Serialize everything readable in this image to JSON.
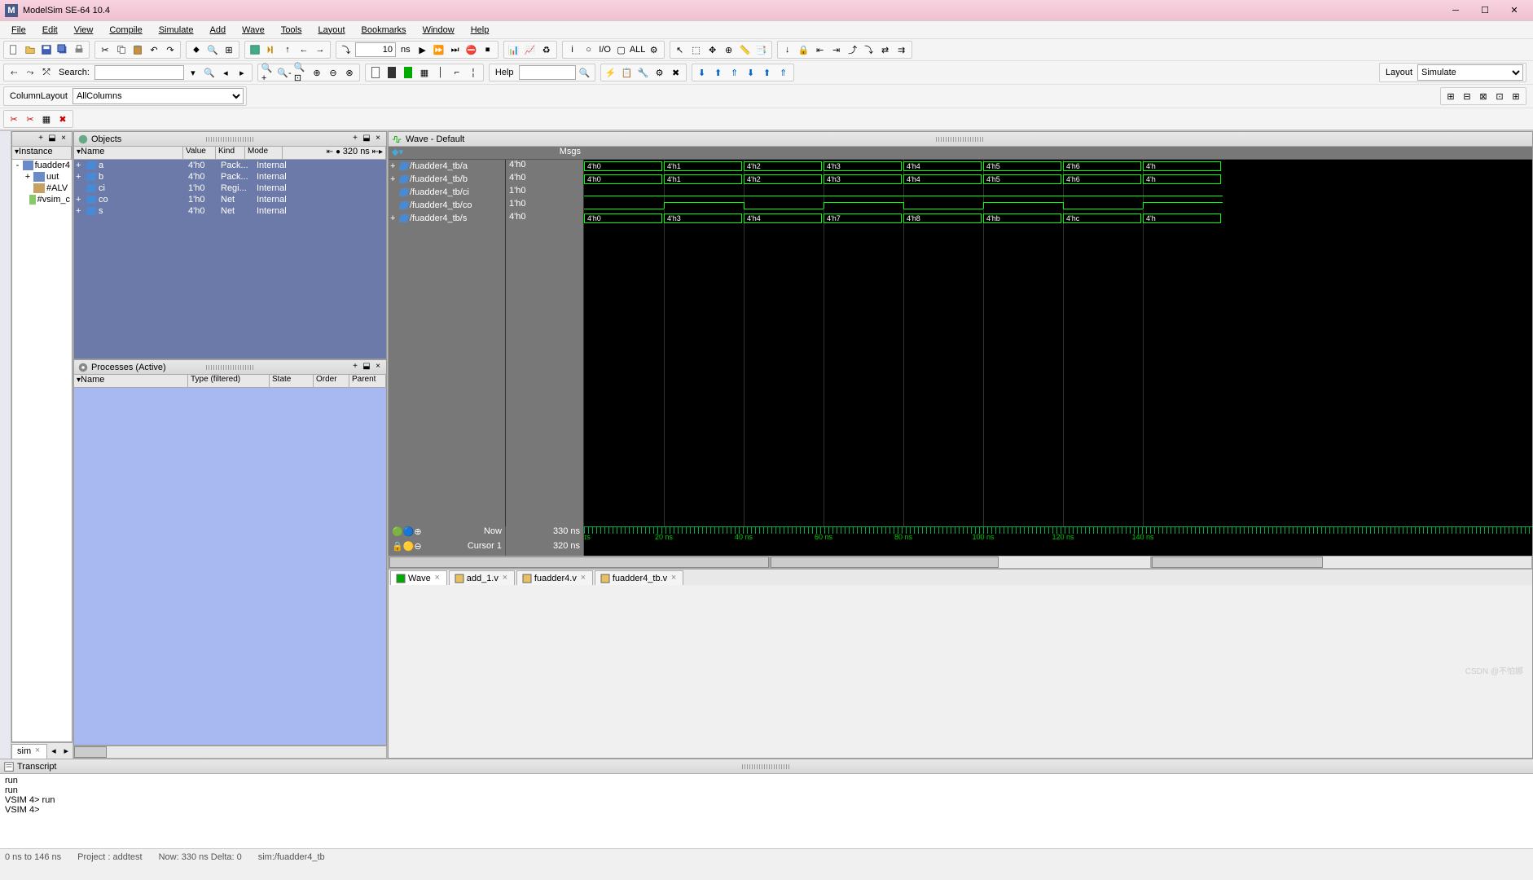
{
  "app": {
    "title": "ModelSim SE-64 10.4",
    "logo": "M"
  },
  "menus": [
    "File",
    "Edit",
    "View",
    "Compile",
    "Simulate",
    "Add",
    "Wave",
    "Tools",
    "Layout",
    "Bookmarks",
    "Window",
    "Help"
  ],
  "toolbar": {
    "time_value": "10",
    "time_unit": "ns",
    "search_label": "Search:",
    "column_layout_label": "ColumnLayout",
    "column_layout_value": "AllColumns",
    "help_label": "Help",
    "layout_label": "Layout",
    "layout_value": "Simulate"
  },
  "instance_panel": {
    "title": "",
    "header": "Instance",
    "items": [
      {
        "exp": "-",
        "icon": "module",
        "label": "fuadder4"
      },
      {
        "exp": "+",
        "icon": "module",
        "label": "uut",
        "indent": 1
      },
      {
        "exp": "",
        "icon": "package",
        "label": "#ALV",
        "indent": 1
      },
      {
        "exp": "",
        "icon": "chart",
        "label": "#vsim_c",
        "indent": 1
      }
    ]
  },
  "objects_panel": {
    "title": "Objects",
    "columns": [
      "Name",
      "Value",
      "Kind",
      "Mode"
    ],
    "time_marker": "320 ns",
    "rows": [
      {
        "exp": "+",
        "name": "a",
        "value": "4'h0",
        "kind": "Pack...",
        "mode": "Internal"
      },
      {
        "exp": "+",
        "name": "b",
        "value": "4'h0",
        "kind": "Pack...",
        "mode": "Internal"
      },
      {
        "exp": "",
        "name": "ci",
        "value": "1'h0",
        "kind": "Regi...",
        "mode": "Internal"
      },
      {
        "exp": "+",
        "name": "co",
        "value": "1'h0",
        "kind": "Net",
        "mode": "Internal"
      },
      {
        "exp": "+",
        "name": "s",
        "value": "4'h0",
        "kind": "Net",
        "mode": "Internal"
      }
    ]
  },
  "processes_panel": {
    "title": "Processes (Active)",
    "columns": [
      "Name",
      "Type (filtered)",
      "State",
      "Order",
      "Parent"
    ]
  },
  "wave_panel": {
    "title": "Wave - Default",
    "msgs_header": "Msgs",
    "signals": [
      {
        "exp": "+",
        "name": "/fuadder4_tb/a",
        "msg": "4'h0"
      },
      {
        "exp": "+",
        "name": "/fuadder4_tb/b",
        "msg": "4'h0"
      },
      {
        "exp": "",
        "name": "/fuadder4_tb/ci",
        "msg": "1'h0"
      },
      {
        "exp": "",
        "name": "/fuadder4_tb/co",
        "msg": "1'h0"
      },
      {
        "exp": "+",
        "name": "/fuadder4_tb/s",
        "msg": "4'h0"
      }
    ],
    "bus_a": [
      "4'h0",
      "4'h1",
      "4'h2",
      "4'h3",
      "4'h4",
      "4'h5",
      "4'h6",
      "4'h"
    ],
    "bus_b": [
      "4'h0",
      "4'h1",
      "4'h2",
      "4'h3",
      "4'h4",
      "4'h5",
      "4'h6",
      "4'h"
    ],
    "bus_s": [
      "4'h0",
      "4'h3",
      "4'h4",
      "4'h7",
      "4'h8",
      "4'hb",
      "4'hc",
      "4'h"
    ],
    "ruler": [
      "20 ns",
      "40 ns",
      "60 ns",
      "80 ns",
      "100 ns",
      "120 ns",
      "140 ns"
    ],
    "now_label": "Now",
    "now_value": "330 ns",
    "cursor_label": "Cursor 1",
    "cursor_value": "320 ns"
  },
  "tabs": {
    "left_tab": "sim",
    "wave_tabs": [
      {
        "label": "Wave",
        "active": true
      },
      {
        "label": "add_1.v"
      },
      {
        "label": "fuadder4.v"
      },
      {
        "label": "fuadder4_tb.v"
      }
    ]
  },
  "transcript": {
    "title": "Transcript",
    "lines": [
      "run",
      "run",
      "VSIM 4> run",
      "",
      "VSIM 4>"
    ]
  },
  "statusbar": {
    "range": "0 ns to 146 ns",
    "project": "Project : addtest",
    "now": "Now: 330 ns  Delta: 0",
    "sim": "sim:/fuadder4_tb"
  },
  "watermark": "CSDN @不怕娜"
}
